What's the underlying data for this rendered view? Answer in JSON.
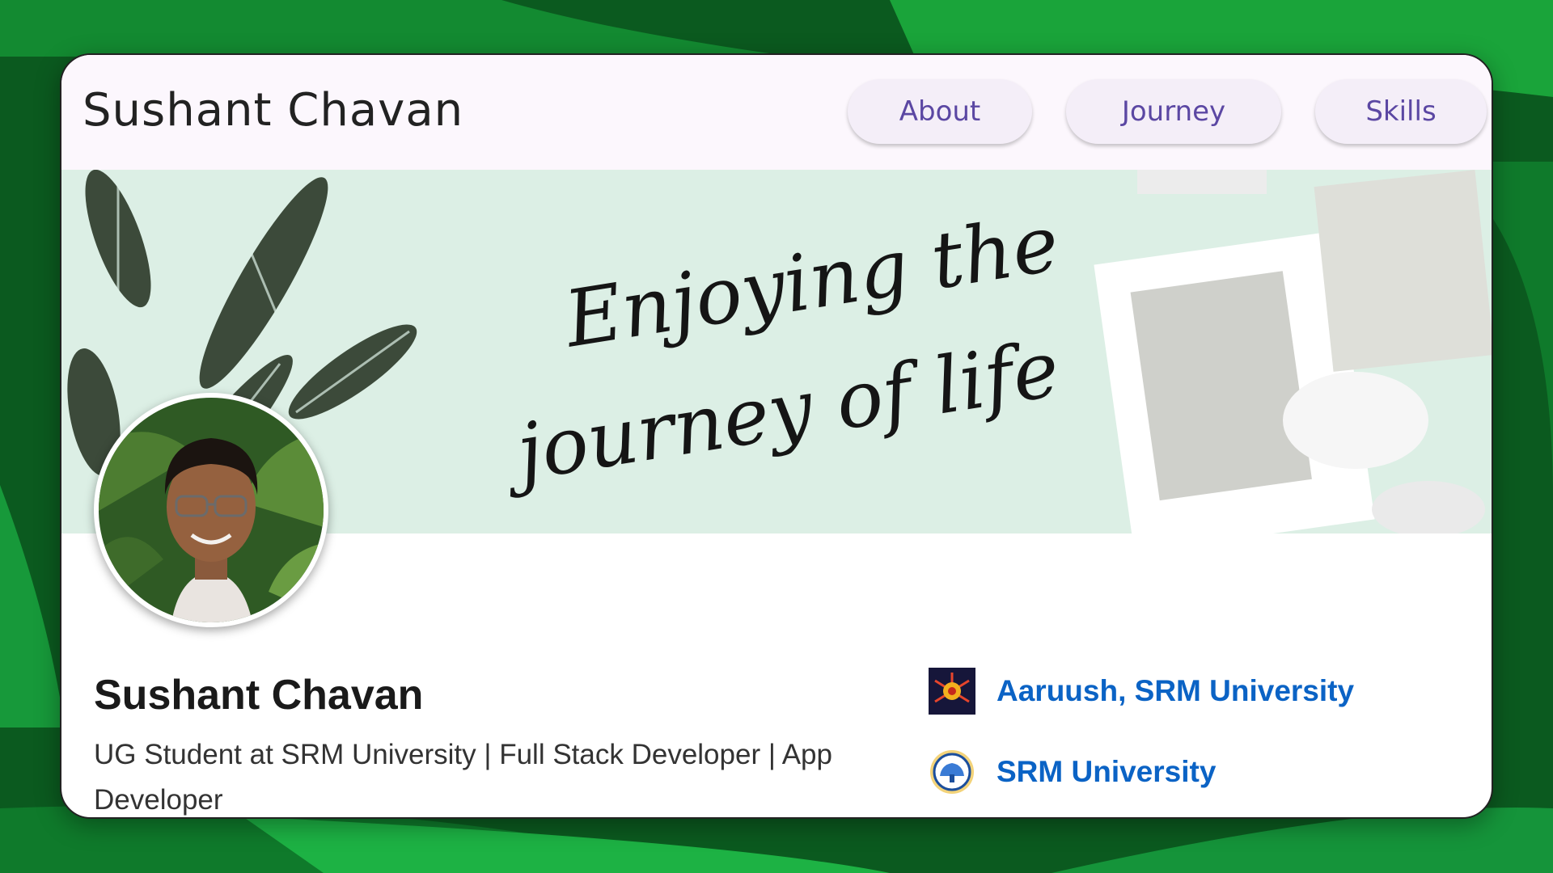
{
  "header": {
    "site_title": "Sushant Chavan",
    "nav": [
      {
        "label": "About"
      },
      {
        "label": "Journey"
      },
      {
        "label": "Skills"
      }
    ]
  },
  "banner": {
    "quote_line_1": "Enjoying the",
    "quote_line_2": "journey of life"
  },
  "profile": {
    "name": "Sushant Chavan",
    "headline": "UG Student at SRM University | Full Stack Developer | App Developer"
  },
  "organizations": [
    {
      "name": "Aaruush, SRM University",
      "icon": "aaruush-logo-icon"
    },
    {
      "name": "SRM University",
      "icon": "srm-logo-icon"
    }
  ],
  "colors": {
    "background_green": "#0b5a1f",
    "nav_text": "#5b47a3",
    "link_blue": "#0b63c5",
    "banner_mint": "#dcefe5"
  }
}
